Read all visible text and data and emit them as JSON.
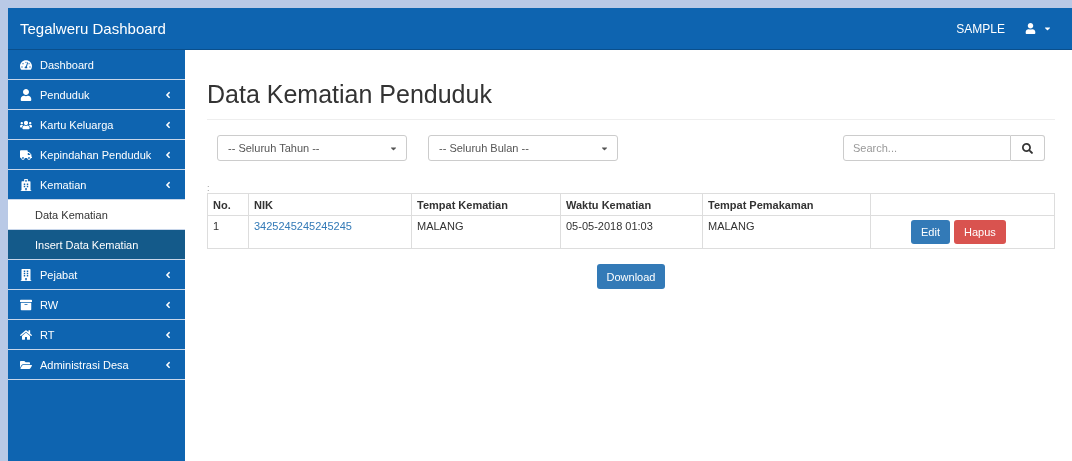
{
  "navbar": {
    "brand": "Tegalweru Dashboard",
    "user": "SAMPLE"
  },
  "sidebar": {
    "items": [
      {
        "label": "Dashboard"
      },
      {
        "label": "Penduduk"
      },
      {
        "label": "Kartu Keluarga"
      },
      {
        "label": "Kepindahan Penduduk"
      },
      {
        "label": "Kematian",
        "children": [
          {
            "label": "Data Kematian",
            "selected": true
          },
          {
            "label": "Insert Data Kematian",
            "selected": false
          }
        ]
      },
      {
        "label": "Pejabat"
      },
      {
        "label": "RW"
      },
      {
        "label": "RT"
      },
      {
        "label": "Administrasi Desa"
      }
    ]
  },
  "page": {
    "title": "Data Kematian Penduduk",
    "filters": [
      {
        "value": "-- Seluruh Tahun --"
      },
      {
        "value": "-- Seluruh Bulan --"
      }
    ],
    "search": {
      "placeholder": "Search..."
    },
    "table_caption": ":",
    "table": {
      "columns": [
        "No.",
        "NIK",
        "Tempat Kematian",
        "Waktu Kematian",
        "Tempat Pemakaman"
      ],
      "rows": [
        {
          "no": "1",
          "nik": "3425245245245245",
          "tempat_kematian": "MALANG",
          "waktu_kematian": "05-05-2018 01:03",
          "tempat_pemakaman": "MALANG",
          "actions": [
            {
              "label": "Edit",
              "kind": "primary"
            },
            {
              "label": "Hapus",
              "kind": "danger"
            }
          ]
        }
      ]
    },
    "download": "Download"
  }
}
